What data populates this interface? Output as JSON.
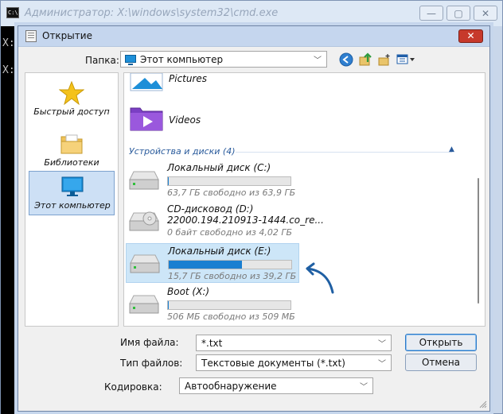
{
  "cmd": {
    "icon_text": "C:\\.",
    "title": "Администратор: X:\\windows\\system32\\cmd.exe",
    "console_lines": [
      "X:",
      "X:"
    ],
    "controls": [
      "—",
      "▢",
      "✕"
    ]
  },
  "dialog": {
    "title": "Открытие",
    "close_glyph": "✕",
    "folder_label": "Папка:",
    "folder_value": "Этот компьютер",
    "toolbar_icons": [
      "back-icon",
      "up-folder-icon",
      "new-folder-icon",
      "view-menu-icon"
    ],
    "colors": {
      "accent": "#1a7fd1",
      "selection": "#cde6f8",
      "group_header": "#2a5b9c"
    }
  },
  "sidebar": {
    "items": [
      {
        "label": "Быстрый доступ",
        "icon": "star-icon"
      },
      {
        "label": "Библиотеки",
        "icon": "libraries-folder-icon"
      },
      {
        "label": "Этот компьютер",
        "icon": "monitor-icon",
        "selected": true
      }
    ]
  },
  "list": {
    "libraries": [
      {
        "label": "Pictures",
        "icon": "pictures-folder-icon"
      },
      {
        "label": "Videos",
        "icon": "videos-folder-icon"
      }
    ],
    "group_header": "Устройства и диски (4)",
    "drives": [
      {
        "name": "Локальный диск (C:)",
        "free": "63,7 ГБ свободно из 63,9 ГБ",
        "used_fraction": 0.003,
        "type": "hdd"
      },
      {
        "name": "CD-дисковод (D:)",
        "label": "22000.194.210913-1444.co_re...",
        "free": "0 байт свободно из 4,02 ГБ",
        "type": "cd"
      },
      {
        "name": "Локальный диск (E:)",
        "free": "15,7 ГБ свободно из 39,2 ГБ",
        "used_fraction": 0.6,
        "type": "hdd",
        "selected": true
      },
      {
        "name": "Boot (X:)",
        "free": "506 МБ свободно из 509 МБ",
        "used_fraction": 0.006,
        "type": "hdd"
      }
    ]
  },
  "form": {
    "filename_label": "Имя файла:",
    "filename_value": "*.txt",
    "filetype_label": "Тип файлов:",
    "filetype_value": "Текстовые документы (*.txt)",
    "encoding_label": "Кодировка:",
    "encoding_value": "Автообнаружение",
    "open_label": "Открыть",
    "cancel_label": "Отмена"
  }
}
